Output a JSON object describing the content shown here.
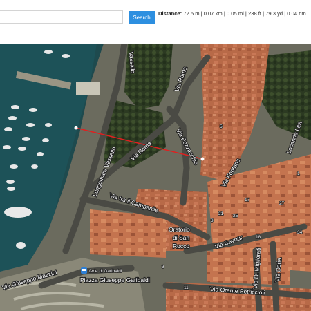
{
  "toolbar": {
    "search_value": "",
    "search_placeholder": "",
    "search_label": "Search",
    "accent": "#2d8fe0"
  },
  "distance": {
    "label": "Distance:",
    "value": "72.5 m | 0.07 km | 0.05 mi | 238 ft | 79.3 yd | 0.04 nm"
  },
  "map": {
    "streets": {
      "lungomare": "Lungomare Vassallo",
      "roma_left": "Via Roma",
      "roma_top": "Via Roma",
      "pozzacchio": "Via Pozzacchio",
      "campanile": "Via tra il Campanile",
      "oratorio": "Oratorio di San Rocco",
      "fontana": "Via Fontana",
      "cavour": "Via Cavour",
      "miglioratti": "Via D. Migliorati",
      "doria": "Via Doria",
      "mazzini": "Via Giuseppe Mazzini",
      "piazza": "Piazza Giuseppe Garibaldi",
      "orante": "Via Orante Petriccioli",
      "locanda": "Locanda Lea",
      "vassallo_top": "Vassallo",
      "garibaldi_bus": "ferie di Garibaldi"
    },
    "numbers": [
      "5",
      "3",
      "17",
      "27",
      "25",
      "11",
      "18",
      "21",
      "34",
      "1",
      "3"
    ],
    "measure_line_color": "#e02020"
  }
}
